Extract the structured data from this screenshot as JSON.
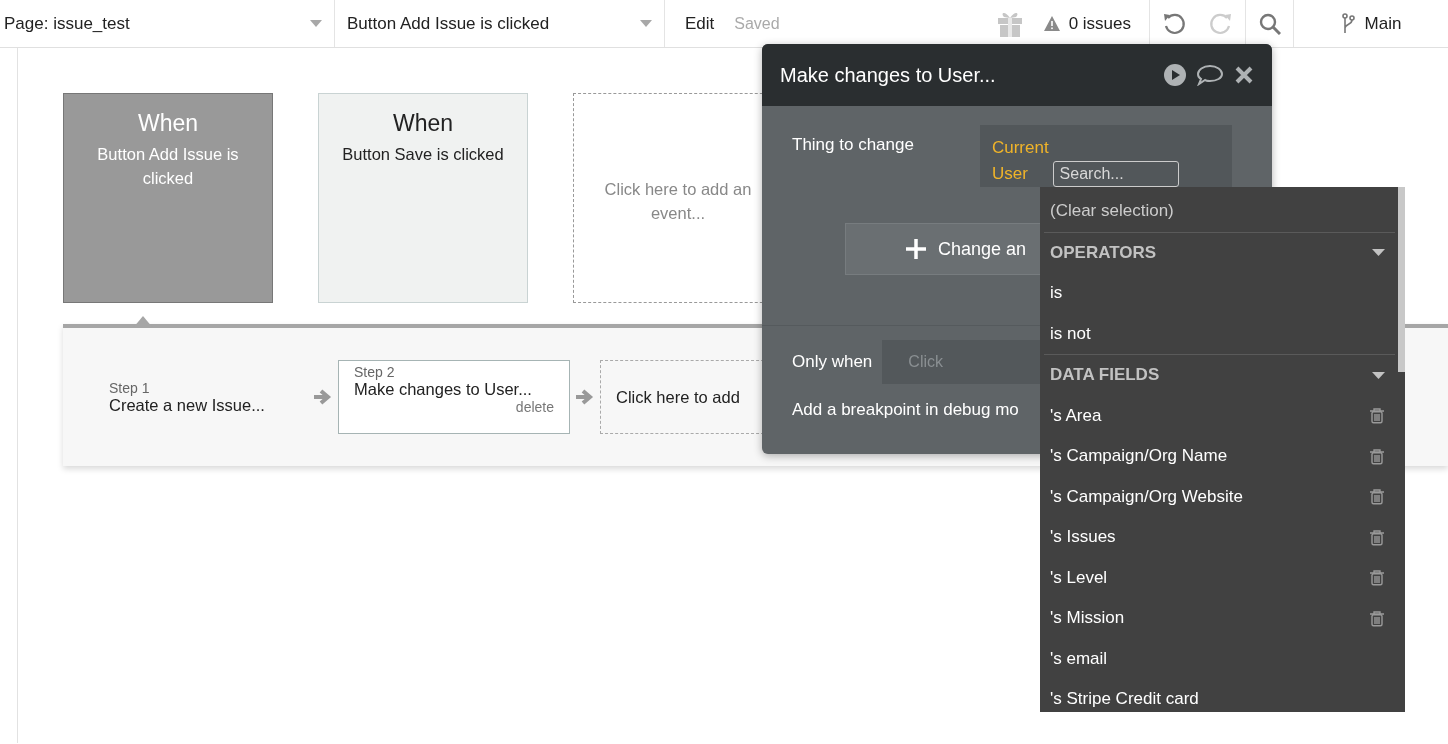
{
  "topbar": {
    "page": "Page: issue_test",
    "workflow": "Button Add Issue is clicked",
    "edit": "Edit",
    "status": "Saved",
    "issues": "0 issues",
    "branch": "Main"
  },
  "events": [
    {
      "kind": "event",
      "heading": "When",
      "label": "Button Add Issue is clicked",
      "selected": true
    },
    {
      "kind": "event",
      "heading": "When",
      "label": "Button Save is clicked",
      "selected": false
    },
    {
      "kind": "add",
      "label": "Click here to add an event..."
    }
  ],
  "steps": [
    {
      "kind": "step",
      "number": "Step 1",
      "label": "Create a new Issue...",
      "selected": false
    },
    {
      "kind": "step",
      "number": "Step 2",
      "label": "Make changes to User...",
      "selected": true,
      "delete": "delete"
    },
    {
      "kind": "add",
      "label": "Click here to add"
    }
  ],
  "popup": {
    "title": "Make changes to User...",
    "thing_label": "Thing to change",
    "thing_value": "Current User",
    "search_placeholder": "Search...",
    "change_button": "Change an",
    "only_when_label": "Only when",
    "only_when_placeholder": "Click",
    "breakpoint": "Add a breakpoint in debug mo"
  },
  "dropdown": {
    "clear": "(Clear selection)",
    "sections": [
      {
        "title": "OPERATORS",
        "expanded": true,
        "items": [
          {
            "label": "is",
            "deletable": false
          },
          {
            "label": "is not",
            "deletable": false
          }
        ]
      },
      {
        "title": "DATA FIELDS",
        "expanded": true,
        "items": [
          {
            "label": "'s Area",
            "deletable": true
          },
          {
            "label": "'s Campaign/Org Name",
            "deletable": true
          },
          {
            "label": "'s Campaign/Org Website",
            "deletable": true
          },
          {
            "label": "'s Issues",
            "deletable": true
          },
          {
            "label": "'s Level",
            "deletable": true
          },
          {
            "label": "'s Mission",
            "deletable": true
          },
          {
            "label": "'s email",
            "deletable": false
          },
          {
            "label": "'s Stripe Credit card",
            "deletable": false
          }
        ]
      }
    ]
  }
}
